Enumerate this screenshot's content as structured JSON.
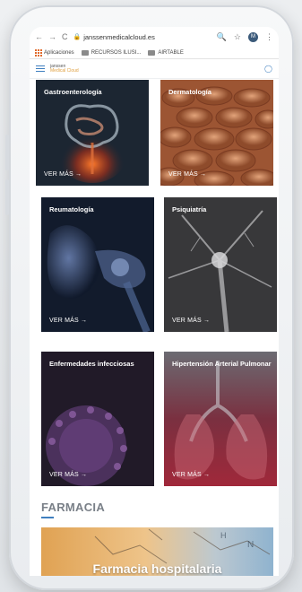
{
  "browser": {
    "url": "janssenmedicalcloud.es",
    "avatar_letter": "M",
    "bookmarks": [
      "Aplicaciones",
      "RECURSOS ILUSI...",
      "AIRTABLE"
    ]
  },
  "site": {
    "logo_line1": "janssen",
    "logo_line2": "Medical Cloud"
  },
  "cards": [
    {
      "title": "Gastroenterología",
      "more": "VER MÁS →",
      "color": "#1f2a36"
    },
    {
      "title": "Dermatología",
      "more": "VER MÁS →",
      "color": "#a8623a"
    },
    {
      "title": "Reumatología",
      "more": "VER MÁS →",
      "color": "#1a2a44"
    },
    {
      "title": "Psiquiatría",
      "more": "VER MÁS →",
      "color": "#3a3a3c"
    },
    {
      "title": "Enfermedades infecciosas",
      "more": "VER MÁS →",
      "color": "#2c2236"
    },
    {
      "title": "Hipertensión Arterial Pulmonar",
      "more": "VER MÁS →",
      "color": "#5a2a36"
    }
  ],
  "section": {
    "title": "FARMACIA"
  },
  "banner": {
    "title": "Farmacia hospitalaria"
  },
  "colors": {
    "accent": "#3f7fbf",
    "logo_accent": "#e0a040"
  }
}
